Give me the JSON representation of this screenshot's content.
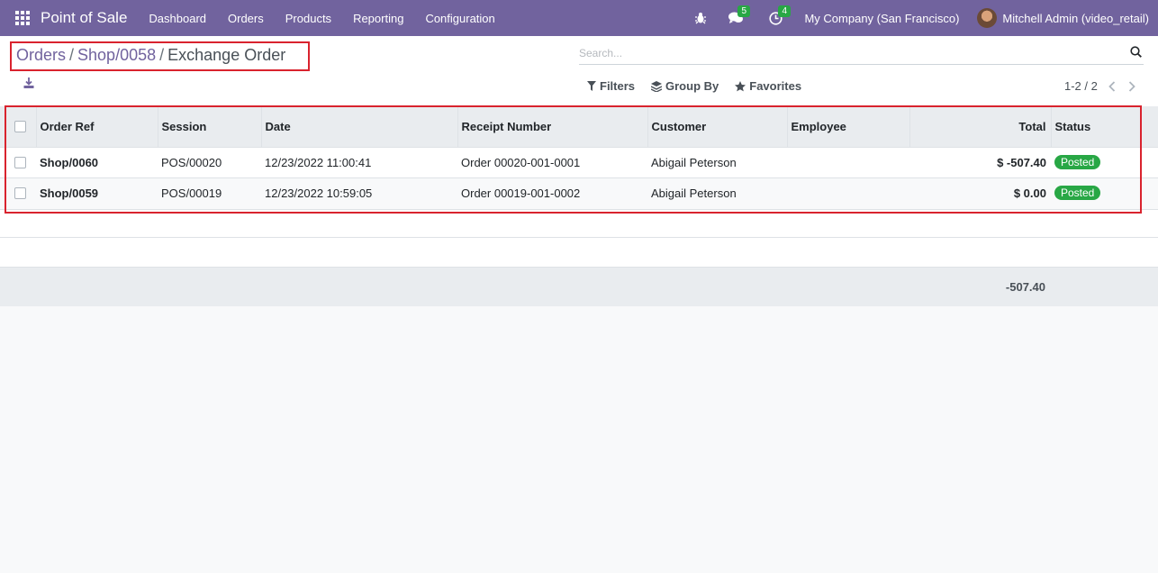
{
  "navbar": {
    "app_name": "Point of Sale",
    "menu": [
      "Dashboard",
      "Orders",
      "Products",
      "Reporting",
      "Configuration"
    ],
    "chat_count": "5",
    "activity_count": "4",
    "company": "My Company (San Francisco)",
    "user": "Mitchell Admin (video_retail)"
  },
  "breadcrumb": {
    "items": [
      "Orders",
      "Shop/0058"
    ],
    "current": "Exchange Order"
  },
  "search": {
    "placeholder": "Search..."
  },
  "filters": {
    "filters_label": "Filters",
    "group_by_label": "Group By",
    "favorites_label": "Favorites"
  },
  "pager": {
    "value": "1-2 / 2"
  },
  "table": {
    "columns": [
      "Order Ref",
      "Session",
      "Date",
      "Receipt Number",
      "Customer",
      "Employee",
      "Total",
      "Status"
    ],
    "rows": [
      {
        "order_ref": "Shop/0060",
        "session": "POS/00020",
        "date": "12/23/2022 11:00:41",
        "receipt": "Order 00020-001-0001",
        "customer": "Abigail Peterson",
        "employee": "",
        "total": "$ -507.40",
        "status": "Posted"
      },
      {
        "order_ref": "Shop/0059",
        "session": "POS/00019",
        "date": "12/23/2022 10:59:05",
        "receipt": "Order 00019-001-0002",
        "customer": "Abigail Peterson",
        "employee": "",
        "total": "$ 0.00",
        "status": "Posted"
      }
    ],
    "footer_total": "-507.40"
  },
  "colors": {
    "navbar": "#71639e",
    "status_posted": "#28a745",
    "highlight_box": "#d9232e"
  }
}
